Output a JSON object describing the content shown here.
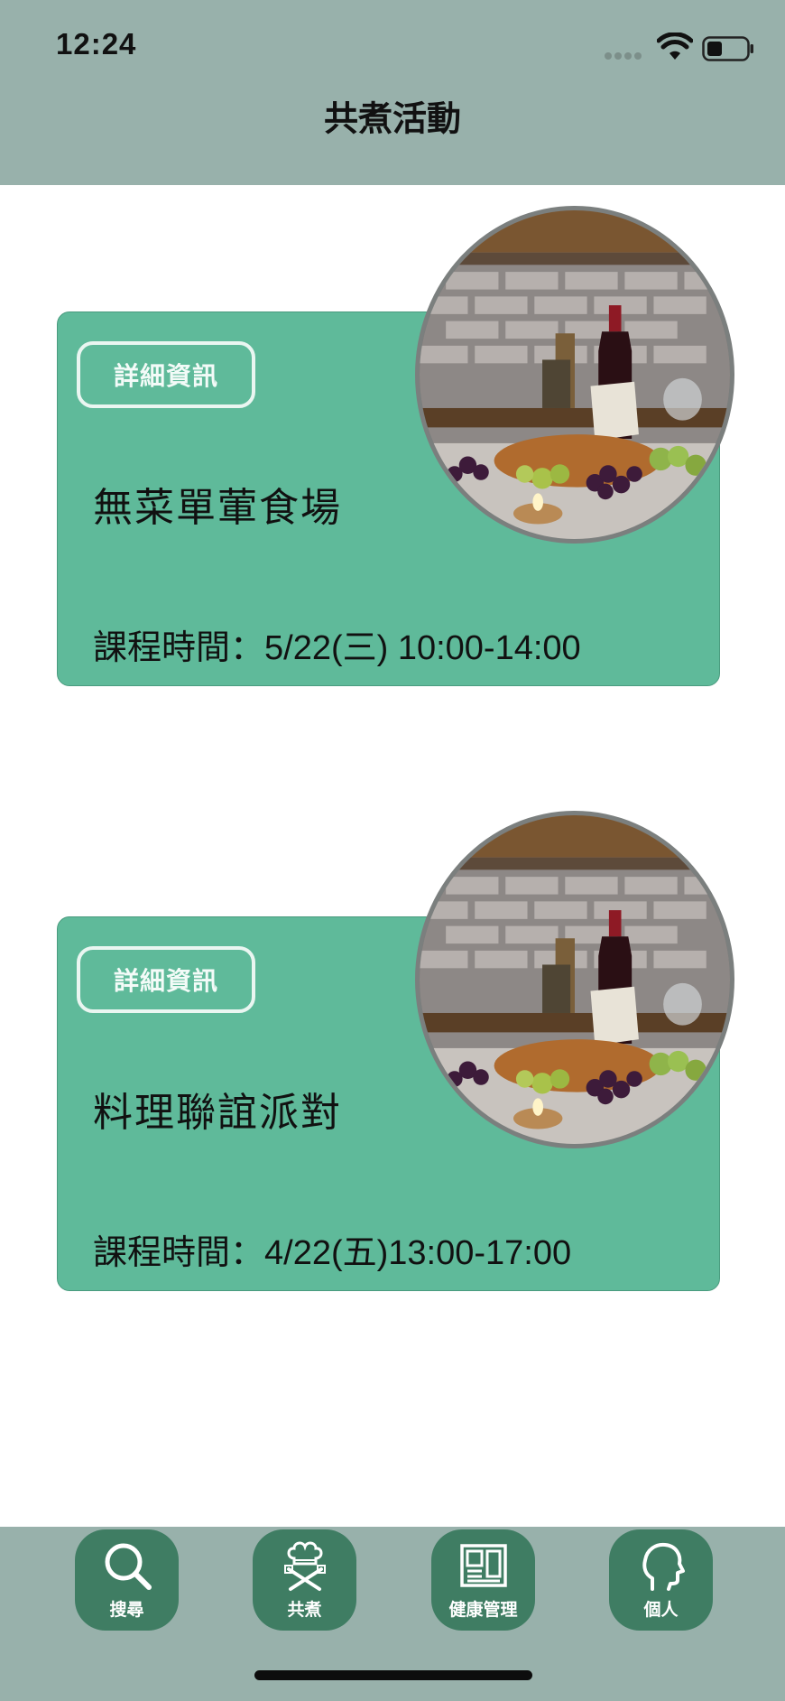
{
  "status_bar": {
    "time": "12:24"
  },
  "header": {
    "title": "共煮活動"
  },
  "events": [
    {
      "detail_label": "詳細資訊",
      "name": "無菜單葷食場",
      "time_text": "課程時間：5/22(三) 10:00-14:00"
    },
    {
      "detail_label": "詳細資訊",
      "name": "料理聯誼派對",
      "time_text": "課程時間：4/22(五)13:00-17:00"
    }
  ],
  "nav": [
    {
      "label": "搜尋",
      "icon": "search-icon"
    },
    {
      "label": "共煮",
      "icon": "chef-utensils-icon"
    },
    {
      "label": "健康管理",
      "icon": "health-record-icon"
    },
    {
      "label": "個人",
      "icon": "person-head-icon"
    }
  ],
  "colors": {
    "header": "#98b1ab",
    "card": "#5fba9a",
    "nav_button": "#3f7d63"
  }
}
